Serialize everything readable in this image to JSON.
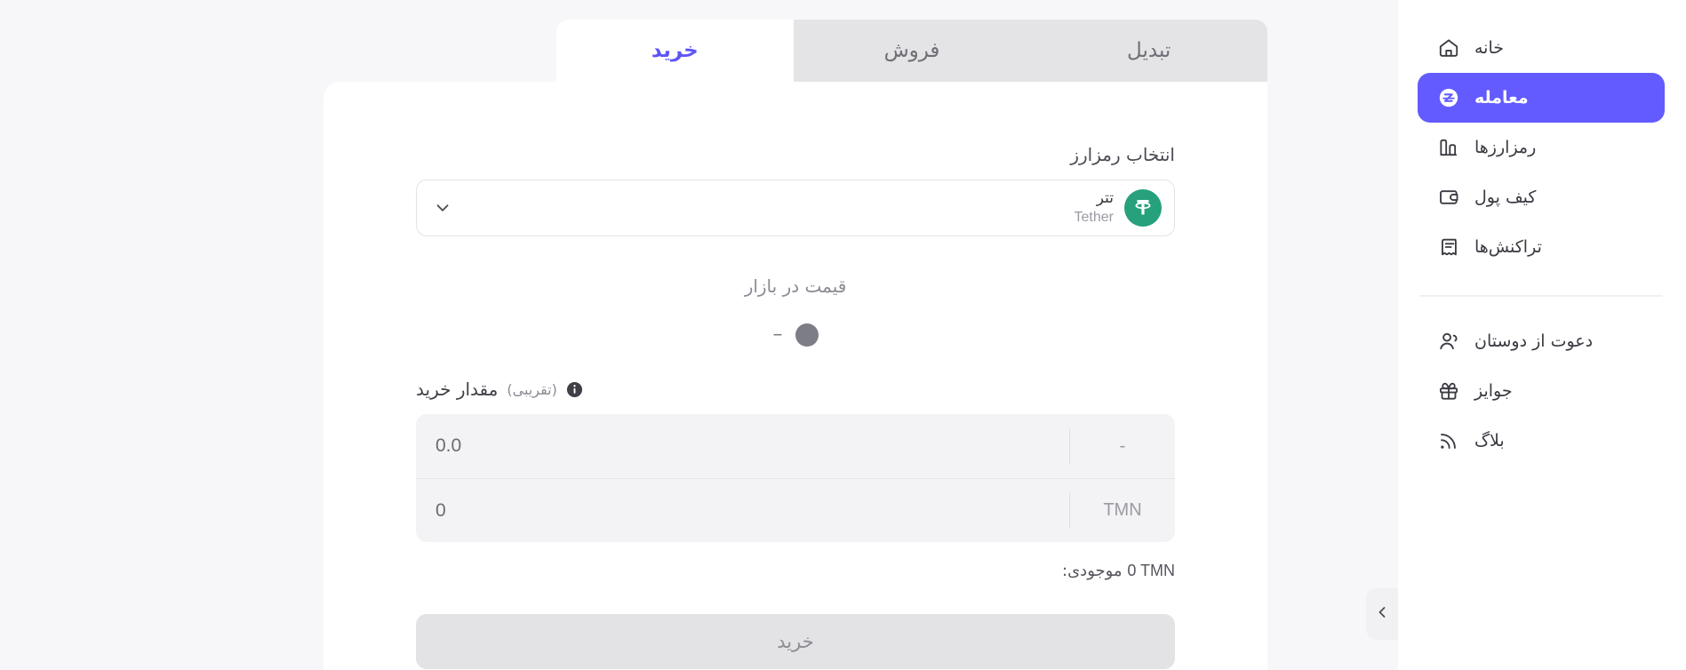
{
  "sidebar": {
    "primary_items": [
      {
        "label": "خانه",
        "icon": "home-icon",
        "active": false
      },
      {
        "label": "معامله",
        "icon": "trade-icon",
        "active": true
      },
      {
        "label": "رمزارزها",
        "icon": "bar-chart-icon",
        "active": false
      },
      {
        "label": "کیف پول",
        "icon": "wallet-icon",
        "active": false
      },
      {
        "label": "تراکنش‌ها",
        "icon": "receipt-icon",
        "active": false
      }
    ],
    "secondary_items": [
      {
        "label": "دعوت از دوستان",
        "icon": "users-icon",
        "active": false
      },
      {
        "label": "جوایز",
        "icon": "gift-icon",
        "active": false
      },
      {
        "label": "بلاگ",
        "icon": "rss-icon",
        "active": false
      }
    ],
    "collapse_icon": "chevron-left-icon"
  },
  "tabs": [
    {
      "label": "تبدیل",
      "active": false
    },
    {
      "label": "فروش",
      "active": false
    },
    {
      "label": "خرید",
      "active": true
    }
  ],
  "form": {
    "select_label": "انتخاب رمزارز",
    "selected_coin": {
      "name_fa": "تتر",
      "name_en": "Tether",
      "symbol_glyph": "₮",
      "logo_color": "#26A17B"
    },
    "chevron_icon": "chevron-down-icon",
    "market_price_label": "قیمت در بازار",
    "market_price_value": "–",
    "amount_label_main": "مقدار خرید",
    "amount_label_sub": "(تقریبی)",
    "info_icon": "info-icon",
    "inputs": [
      {
        "unit": "-",
        "value": "0.0"
      },
      {
        "unit": "TMN",
        "value": "0"
      }
    ],
    "balance_label": "موجودی:",
    "balance_value": "0 TMN",
    "submit_label": "خرید"
  },
  "colors": {
    "accent": "#635BFF",
    "accent_text": "#5D55F5",
    "tether_green": "#26A17B",
    "page_bg": "#F7F7F9",
    "tab_inactive_bg": "#E4E4E6",
    "input_bg": "#F3F3F5",
    "submit_bg": "#E3E3E5"
  }
}
